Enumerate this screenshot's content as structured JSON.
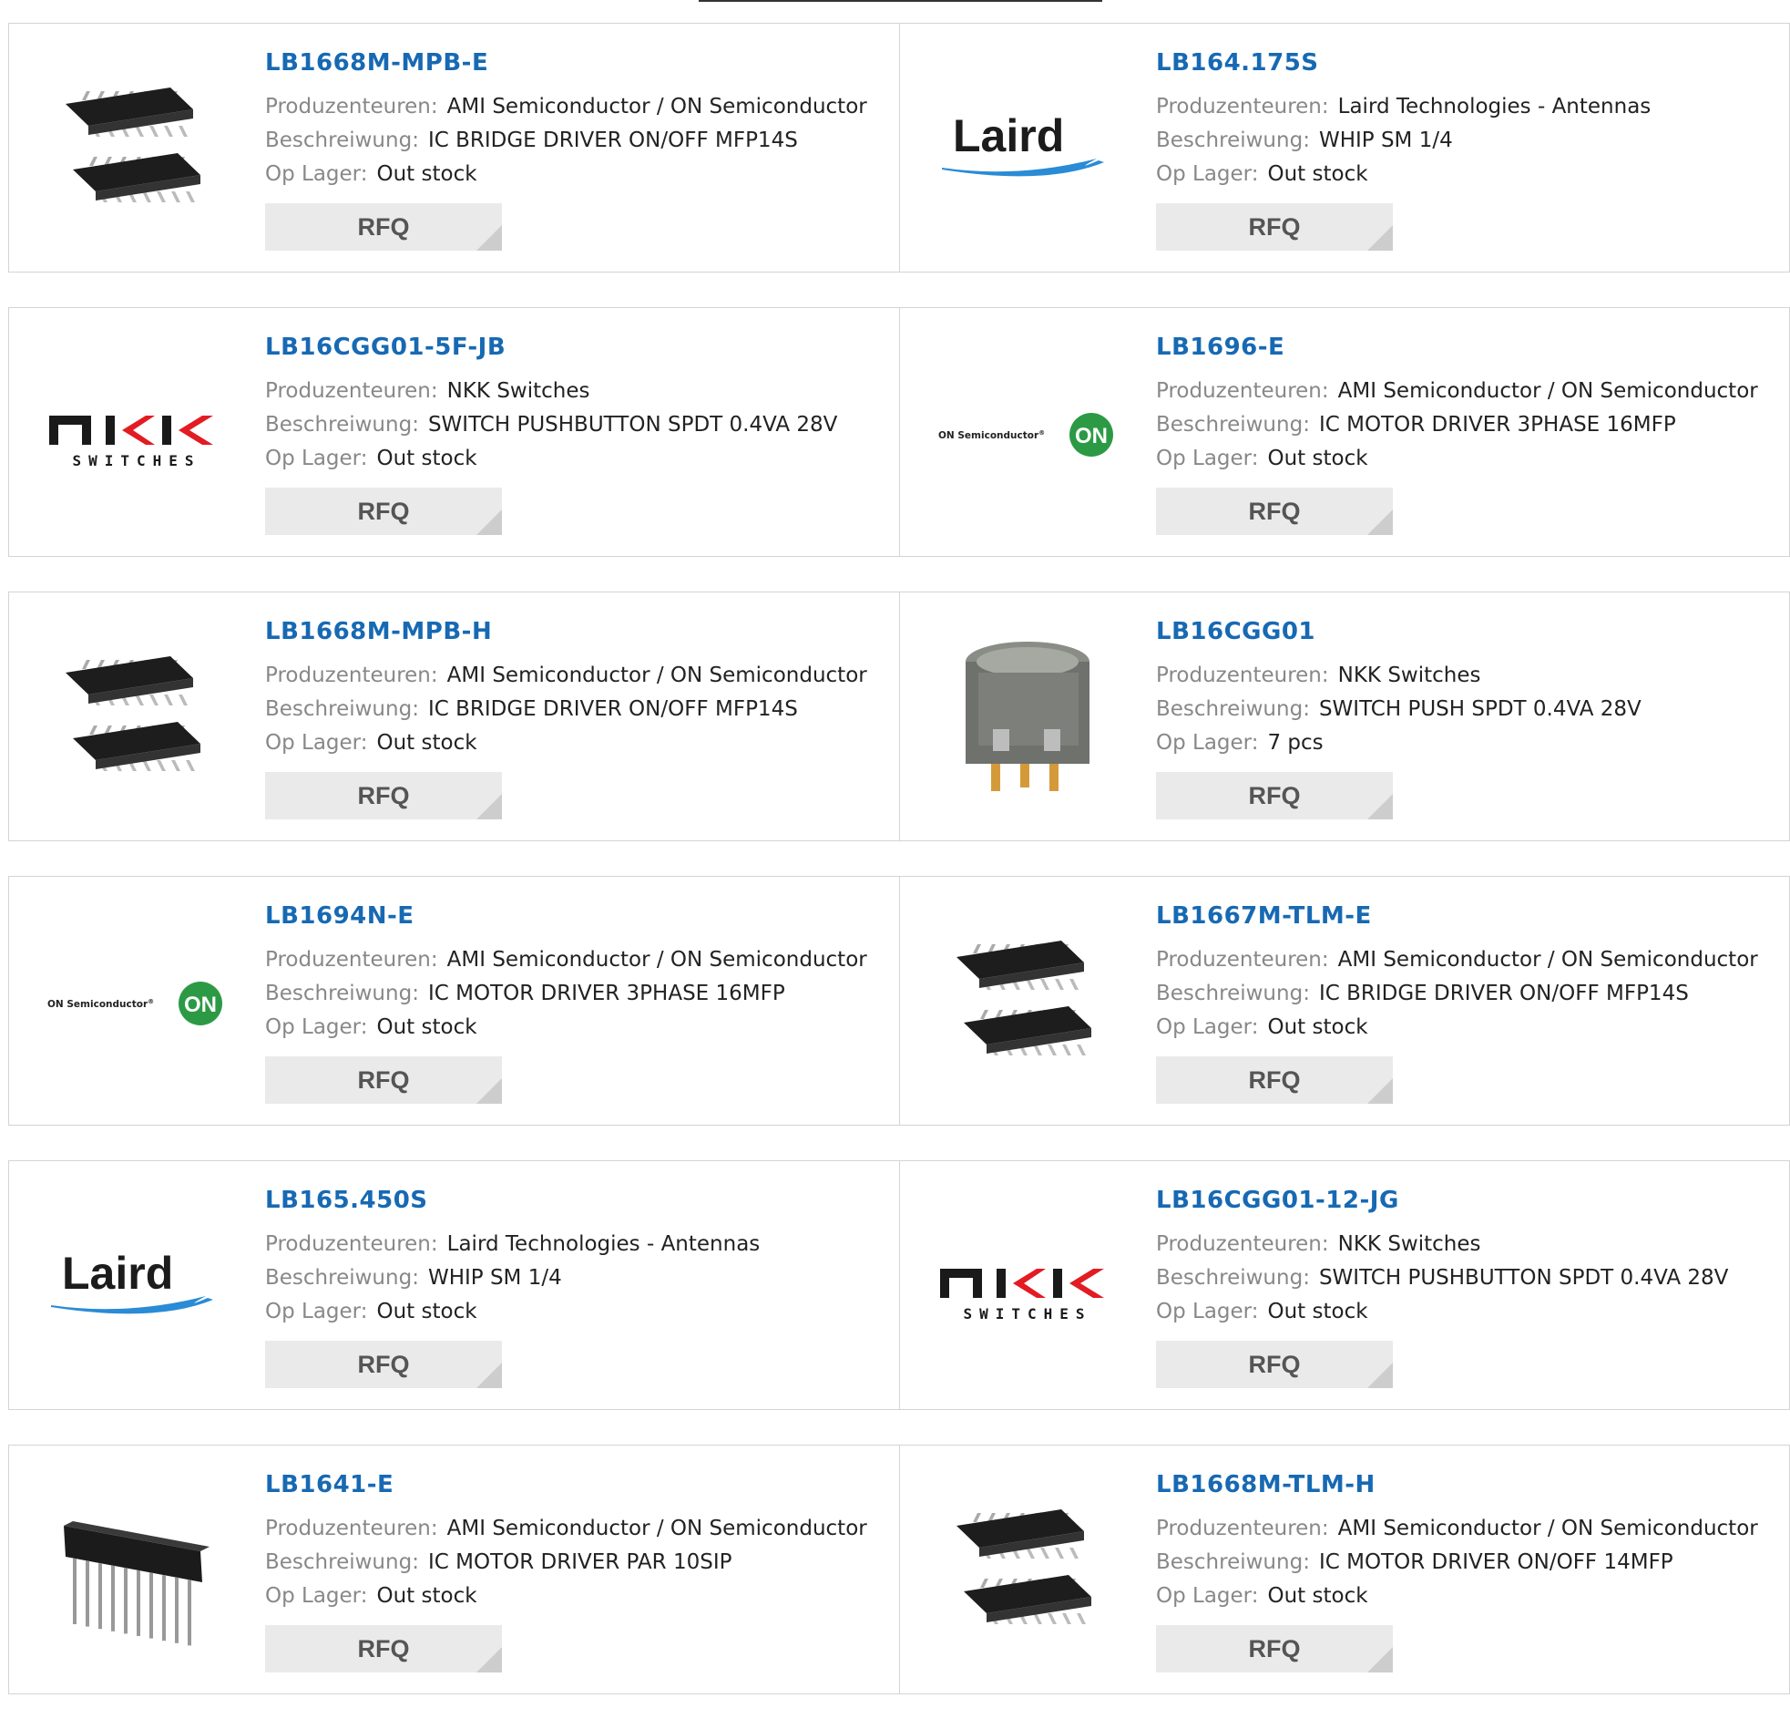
{
  "labels": {
    "manufacturer": "Produzenteuren:",
    "description": "Beschreiwung:",
    "stock": "Op Lager:",
    "rfq": "RFQ"
  },
  "products": [
    {
      "part": "LB1668M-MPB-E",
      "manufacturer": "AMI Semiconductor / ON Semiconductor",
      "description": "IC BRIDGE DRIVER ON/OFF MFP14S",
      "stock": "Out stock",
      "image": "soic14-chip-icon"
    },
    {
      "part": "LB164.175S",
      "manufacturer": "Laird Technologies - Antennas",
      "description": "WHIP SM 1/4",
      "stock": "Out stock",
      "image": "laird-logo"
    },
    {
      "part": "LB16CGG01-5F-JB",
      "manufacturer": "NKK Switches",
      "description": "SWITCH PUSHBUTTON SPDT 0.4VA 28V",
      "stock": "Out stock",
      "image": "nkk-logo"
    },
    {
      "part": "LB1696-E",
      "manufacturer": "AMI Semiconductor / ON Semiconductor",
      "description": "IC MOTOR DRIVER 3PHASE 16MFP",
      "stock": "Out stock",
      "image": "on-semi-logo"
    },
    {
      "part": "LB1668M-MPB-H",
      "manufacturer": "AMI Semiconductor / ON Semiconductor",
      "description": "IC BRIDGE DRIVER ON/OFF MFP14S",
      "stock": "Out stock",
      "image": "soic14-chip-icon"
    },
    {
      "part": "LB16CGG01",
      "manufacturer": "NKK Switches",
      "description": "SWITCH PUSH SPDT 0.4VA 28V",
      "stock": "7 pcs",
      "image": "pushbutton-switch-icon"
    },
    {
      "part": "LB1694N-E",
      "manufacturer": "AMI Semiconductor / ON Semiconductor",
      "description": "IC MOTOR DRIVER 3PHASE 16MFP",
      "stock": "Out stock",
      "image": "on-semi-logo"
    },
    {
      "part": "LB1667M-TLM-E",
      "manufacturer": "AMI Semiconductor / ON Semiconductor",
      "description": "IC BRIDGE DRIVER ON/OFF MFP14S",
      "stock": "Out stock",
      "image": "soic14-chip-icon"
    },
    {
      "part": "LB165.450S",
      "manufacturer": "Laird Technologies - Antennas",
      "description": "WHIP SM 1/4",
      "stock": "Out stock",
      "image": "laird-logo"
    },
    {
      "part": "LB16CGG01-12-JG",
      "manufacturer": "NKK Switches",
      "description": "SWITCH PUSHBUTTON SPDT 0.4VA 28V",
      "stock": "Out stock",
      "image": "nkk-logo"
    },
    {
      "part": "LB1641-E",
      "manufacturer": "AMI Semiconductor / ON Semiconductor",
      "description": "IC MOTOR DRIVER PAR 10SIP",
      "stock": "Out stock",
      "image": "sip10-chip-icon"
    },
    {
      "part": "LB1668M-TLM-H",
      "manufacturer": "AMI Semiconductor / ON Semiconductor",
      "description": "IC MOTOR DRIVER ON/OFF 14MFP",
      "stock": "Out stock",
      "image": "soic14-chip-icon"
    }
  ],
  "logos": {
    "laird": "Laird",
    "nkk_top": "NKK",
    "nkk_bottom": "SWITCHES",
    "on_text": "ON Semiconductor",
    "on_mark": "ON"
  },
  "colors": {
    "link": "#1769b3",
    "laird_blue": "#2a8bd6",
    "nkk_red": "#e31b23",
    "on_green": "#2c9a45"
  }
}
